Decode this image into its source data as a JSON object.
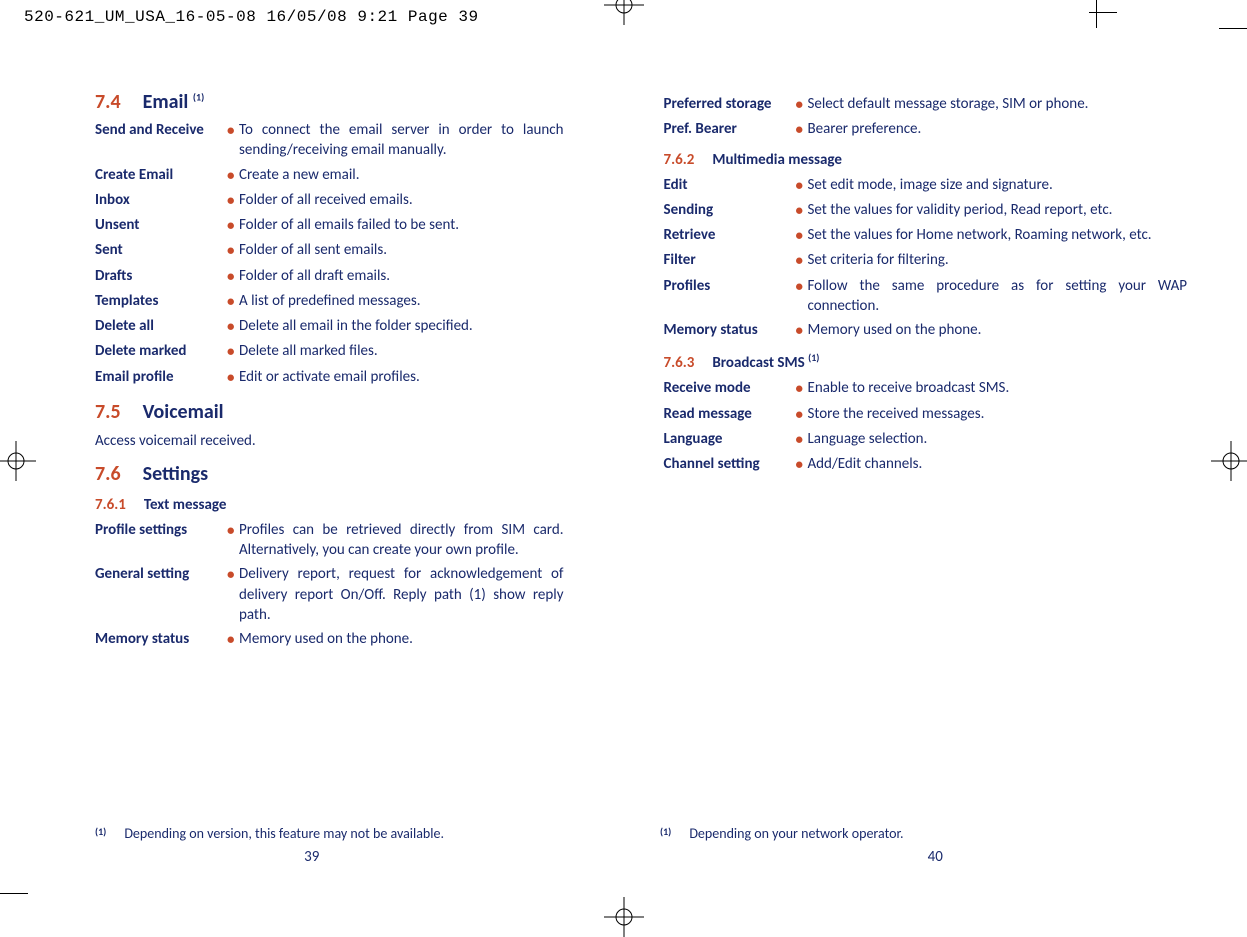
{
  "header_slug": "520-621_UM_USA_16-05-08  16/05/08  9:21  Page 39",
  "left_page_num": "39",
  "right_page_num": "40",
  "footnote_left": {
    "mark": "(1)",
    "text": "Depending on version, this feature may not be available."
  },
  "footnote_right": {
    "mark": "(1)",
    "text": "Depending on your network operator."
  },
  "s74": {
    "num": "7.4",
    "title": "Email",
    "sup": "(1)"
  },
  "s74_rows": [
    {
      "label": "Send and Receive",
      "desc": "To connect the email server in order to launch sending/receiving email manually."
    },
    {
      "label": "Create Email",
      "desc": "Create a new email."
    },
    {
      "label": "Inbox",
      "desc": "Folder of all received emails."
    },
    {
      "label": "Unsent",
      "desc": "Folder of all emails failed to be sent."
    },
    {
      "label": "Sent",
      "desc": "Folder of all sent emails."
    },
    {
      "label": "Drafts",
      "desc": "Folder of all draft emails."
    },
    {
      "label": "Templates",
      "desc": "A list of predefined messages."
    },
    {
      "label": "Delete all",
      "desc": "Delete all email in the folder specified."
    },
    {
      "label": "Delete marked",
      "desc": "Delete all marked files."
    },
    {
      "label": "Email profile",
      "desc": "Edit or activate email profiles."
    }
  ],
  "s75": {
    "num": "7.5",
    "title": "Voicemail",
    "plain": "Access voicemail received."
  },
  "s76": {
    "num": "7.6",
    "title": "Settings"
  },
  "s761": {
    "num": "7.6.1",
    "title": "Text message"
  },
  "s761_rows": [
    {
      "label": "Profile settings",
      "desc": "Profiles can be retrieved directly from SIM card. Alternatively, you can create your own profile."
    },
    {
      "label": "General setting",
      "desc": "Delivery report, request for acknowledgement of delivery report On/Off. Reply path (1) show reply path."
    },
    {
      "label": "Memory status",
      "desc": "Memory used on the phone."
    }
  ],
  "right_top_rows": [
    {
      "label": "Preferred storage",
      "desc": "Select default message storage, SIM or phone."
    },
    {
      "label": "Pref. Bearer",
      "desc": "Bearer preference."
    }
  ],
  "s762": {
    "num": "7.6.2",
    "title": "Multimedia message"
  },
  "s762_rows": [
    {
      "label": "Edit",
      "desc": "Set edit mode, image size and signature."
    },
    {
      "label": "Sending",
      "desc": "Set the values for validity period, Read report, etc."
    },
    {
      "label": "Retrieve",
      "desc": "Set the values for Home network, Roaming network, etc."
    },
    {
      "label": "Filter",
      "desc": "Set criteria for filtering."
    },
    {
      "label": "Profiles",
      "desc": "Follow the same procedure as for setting your WAP connection."
    },
    {
      "label": "Memory status",
      "desc": "Memory used on the phone."
    }
  ],
  "s763": {
    "num": "7.6.3",
    "title": "Broadcast SMS",
    "sup": "(1)"
  },
  "s763_rows": [
    {
      "label": "Receive mode",
      "desc": "Enable to receive broadcast SMS."
    },
    {
      "label": "Read message",
      "desc": "Store the received messages."
    },
    {
      "label": "Language",
      "desc": "Language selection."
    },
    {
      "label": "Channel setting",
      "desc": "Add/Edit channels."
    }
  ]
}
